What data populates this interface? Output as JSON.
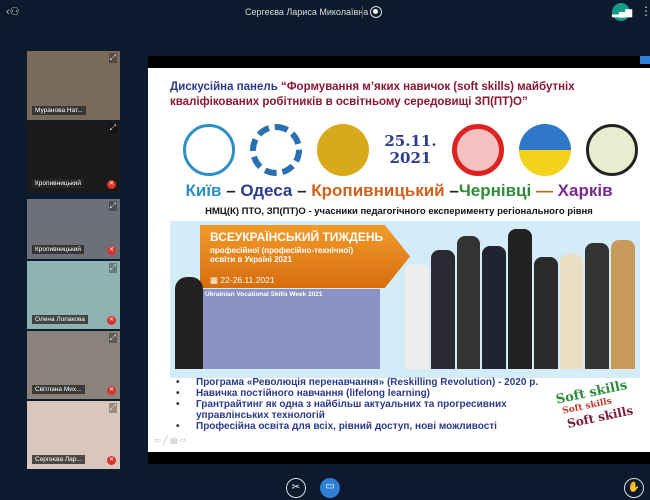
{
  "header": {
    "title": "Сергеєва Лариса Миколаївна",
    "icons": [
      "participants-icon",
      "record-icon",
      "signal-icon",
      "more-icon"
    ]
  },
  "participants": [
    {
      "name": "Муранова Нат...",
      "muted": false,
      "bg": "#7a6a5c"
    },
    {
      "name": "Кропивницький",
      "muted": true,
      "bg": "#1a1a1a"
    },
    {
      "name": "Кропивницький",
      "muted": true,
      "bg": "#6d7078"
    },
    {
      "name": "Олена Лопакова",
      "muted": true,
      "bg": "#8fb3b0"
    },
    {
      "name": "Світлана Мих...",
      "muted": true,
      "bg": "#8a837c"
    },
    {
      "name": "Сергеєва Лар...",
      "muted": true,
      "bg": "#d9c7be"
    }
  ],
  "slide": {
    "title_lead": "Дискусійна панель ",
    "title_main": "“Формування м’яких навичок (soft skills) майбутніх кваліфікованих робітників в освітньому середовищі ЗП(ПТ)О”",
    "date_line1": "25.11.",
    "date_line2": "2021",
    "cities": [
      {
        "t": "Київ",
        "c": "#2a8fc4"
      },
      {
        "t": " – ",
        "c": "#222"
      },
      {
        "t": "Одеса",
        "c": "#2b3a8c"
      },
      {
        "t": " – ",
        "c": "#222"
      },
      {
        "t": "Кропивницький",
        "c": "#d2601a"
      },
      {
        "t": " –",
        "c": "#222"
      },
      {
        "t": "Чернівці",
        "c": "#2e8b3a"
      },
      {
        "t": " — ",
        "c": "#d2601a"
      },
      {
        "t": "Харків",
        "c": "#7a2a8c"
      }
    ],
    "subtitle": "НМЦ(К) ПТО, ЗП(ПТ)О - учасники педагогічного експерименту регіонального рівня",
    "banner": {
      "title": "ВСЕУКРАЇНСЬКИЙ ТИЖДЕНЬ",
      "subtitle": "професійної (професійно-технічної) освіти в Україні 2021",
      "dates": "22-26.11.2021",
      "english": "Ukrainian Vocational Skills Week 2021"
    },
    "bullets": [
      "Програма «Революція перенавчання» (Reskilling Revolution) - 2020 р.",
      "Навичка постійного навчання   (lifelong learning)",
      "Грантрайтинг як одна з найбільш актуальних та прогресивних управлінських технологій",
      "Професійна освіта для всіх, рівний доступ, нові можливості"
    ],
    "soft_skills": [
      "Soft skills",
      "Soft skills",
      "Soft skills"
    ]
  },
  "colors": {
    "accent": "#2f7fd6",
    "bg": "#0b1a2c"
  }
}
